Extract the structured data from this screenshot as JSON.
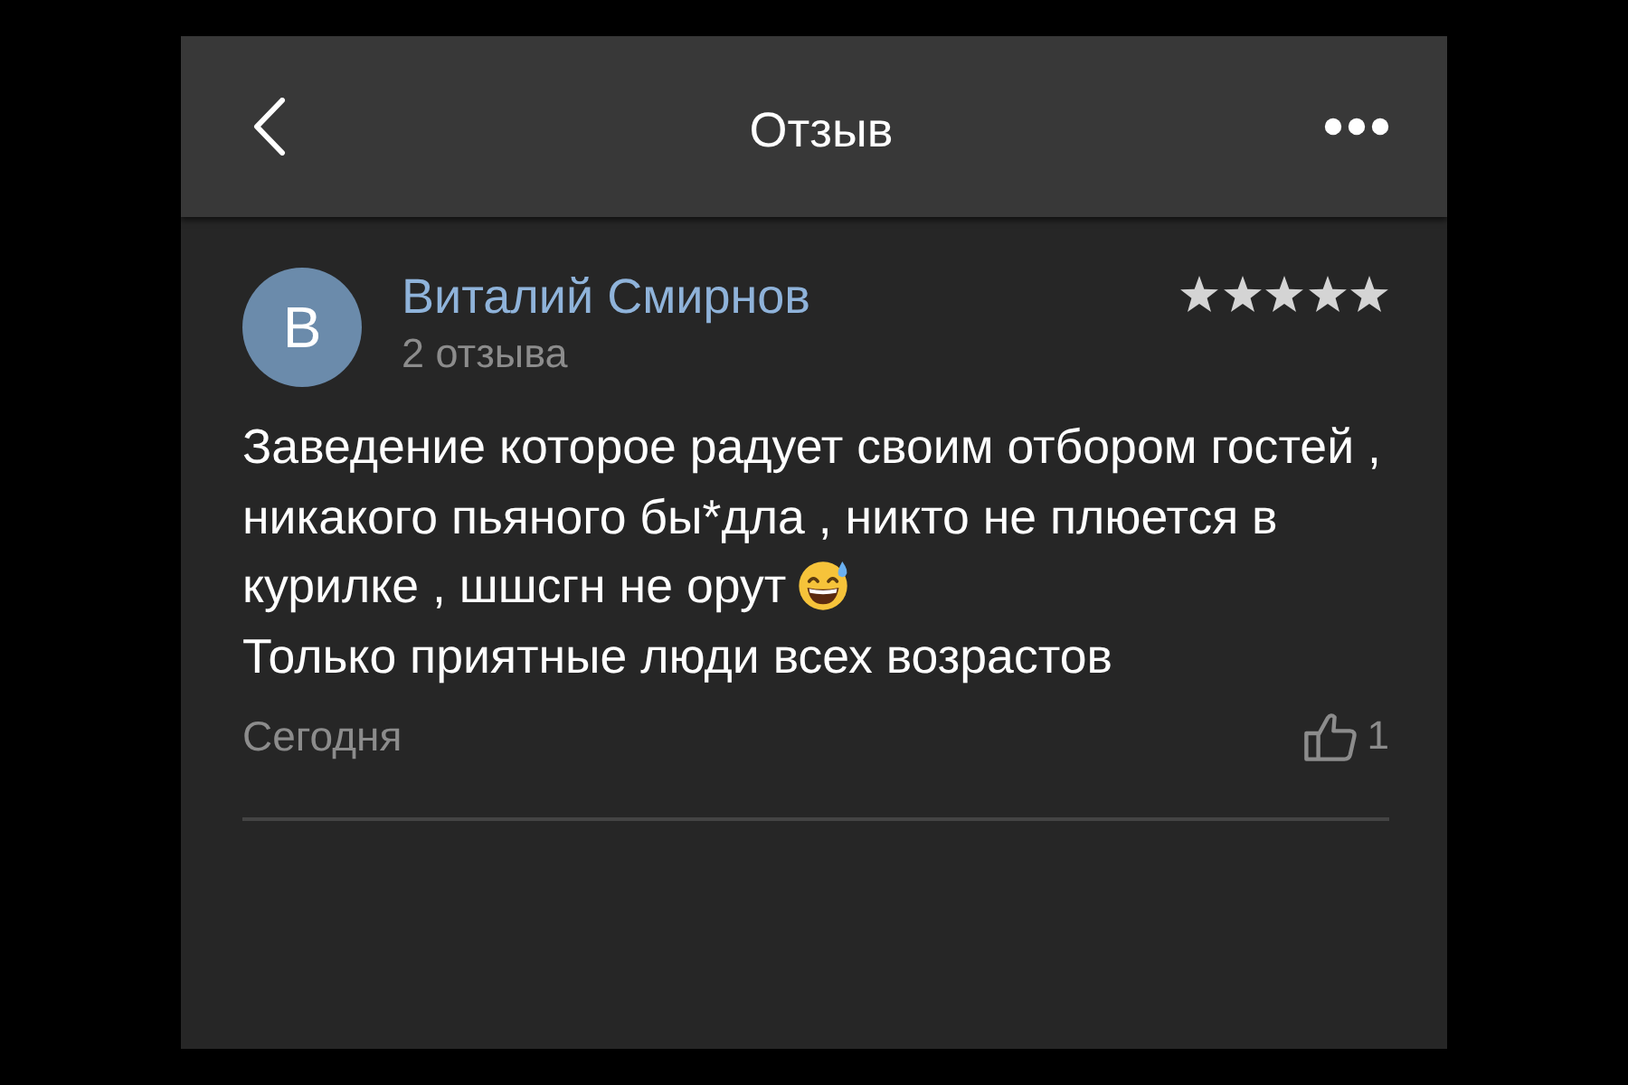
{
  "header": {
    "title": "Отзыв"
  },
  "review": {
    "author": {
      "initial": "В",
      "name": "Виталий Смирнов",
      "review_count": "2 отзыва"
    },
    "stars": 5,
    "body": [
      {
        "text": "Заведение которое радует своим отбором гостей , никакого пьяного бы*дла , никто не плюется в курилке , шшсгн не орут",
        "emoji": true
      },
      {
        "text": "Только приятные люди всех возрастов",
        "emoji": false
      }
    ],
    "date": "Сегодня",
    "likes": "1"
  }
}
